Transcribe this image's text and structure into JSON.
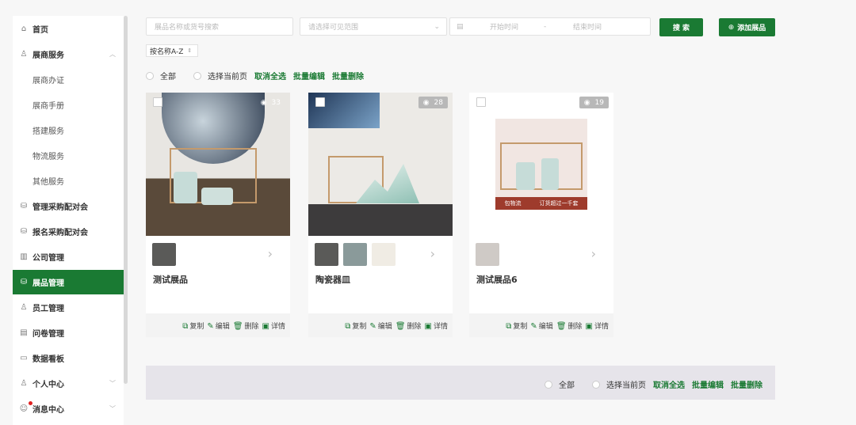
{
  "sidebar": {
    "items": [
      {
        "label": "首页",
        "icon": "home-icon"
      },
      {
        "label": "展商服务",
        "icon": "user-icon",
        "expanded": true
      },
      {
        "label": "展商办证",
        "sub": true
      },
      {
        "label": "展商手册",
        "sub": true
      },
      {
        "label": "搭建服务",
        "sub": true
      },
      {
        "label": "物流服务",
        "sub": true
      },
      {
        "label": "其他服务",
        "sub": true
      },
      {
        "label": "管理采购配对会",
        "icon": "database-icon"
      },
      {
        "label": "报名采购配对会",
        "icon": "database-icon"
      },
      {
        "label": "公司管理",
        "icon": "building-icon"
      },
      {
        "label": "展品管理",
        "icon": "database-icon",
        "active": true
      },
      {
        "label": "员工管理",
        "icon": "users-icon"
      },
      {
        "label": "问卷管理",
        "icon": "form-icon"
      },
      {
        "label": "数据看板",
        "icon": "board-icon"
      },
      {
        "label": "个人中心",
        "icon": "user-icon"
      },
      {
        "label": "消息中心",
        "icon": "message-icon"
      }
    ]
  },
  "filters": {
    "search_placeholder": "展品名称或货号搜索",
    "scope_placeholder": "请选择可见范围",
    "start_placeholder": "开始时间",
    "sep": "-",
    "end_placeholder": "结束时间",
    "search_button": "搜 索",
    "add_button": "添加展品",
    "sort": "按名称A-Z"
  },
  "selection": {
    "all": "全部",
    "current_page": "选择当前页",
    "cancel_all": "取消全选",
    "batch_edit": "批量编辑",
    "batch_delete": "批量删除"
  },
  "actions": {
    "copy": "复制",
    "edit": "编辑",
    "delete": "删除",
    "detail": "详情"
  },
  "products": [
    {
      "name": "测试展品",
      "views": "33",
      "thumbs": 1
    },
    {
      "name": "陶瓷器皿",
      "views": "28",
      "thumbs": 3
    },
    {
      "name": "测试展品6",
      "views": "19",
      "thumbs": 1,
      "banner_left": "包物流",
      "banner_right": "订货超过一千套"
    }
  ],
  "colors": {
    "accent": "#1a7a33"
  }
}
